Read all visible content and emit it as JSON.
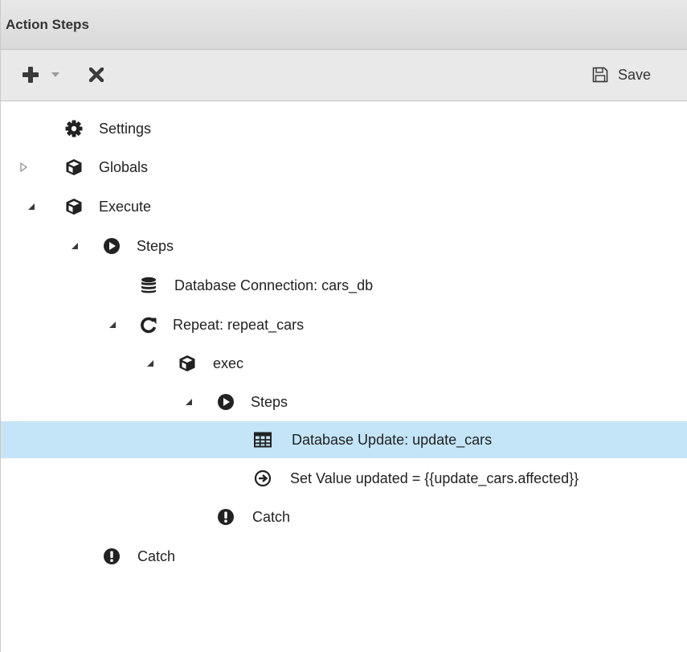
{
  "panel": {
    "title": "Action Steps"
  },
  "toolbar": {
    "add_icon": "plus-icon",
    "add_dropdown_icon": "caret-down-icon",
    "delete_icon": "close-icon",
    "save_icon": "floppy-disk-icon",
    "save_label": "Save"
  },
  "tree": {
    "nodes": [
      {
        "label": "Settings",
        "icon": "gear-icon",
        "toggle": "none",
        "depth": 0
      },
      {
        "label": "Globals",
        "icon": "cube-icon",
        "toggle": "collapsed",
        "depth": 0
      },
      {
        "label": "Execute",
        "icon": "cube-icon",
        "toggle": "expanded",
        "depth": 0
      },
      {
        "label": "Steps",
        "icon": "play-circle-icon",
        "toggle": "expanded",
        "depth": 1
      },
      {
        "label": "Database Connection: cars_db",
        "icon": "database-icon",
        "toggle": "none",
        "depth": 2
      },
      {
        "label": "Repeat: repeat_cars",
        "icon": "refresh-icon",
        "toggle": "expanded",
        "depth": 2
      },
      {
        "label": "exec",
        "icon": "cube-icon",
        "toggle": "expanded",
        "depth": 3
      },
      {
        "label": "Steps",
        "icon": "play-circle-icon",
        "toggle": "expanded",
        "depth": 4
      },
      {
        "label": "Database Update: update_cars",
        "icon": "table-icon",
        "toggle": "none",
        "depth": 5,
        "selected": true
      },
      {
        "label": "Set Value updated = {{update_cars.affected}}",
        "icon": "arrow-circle-right-icon",
        "toggle": "none",
        "depth": 5
      },
      {
        "label": "Catch",
        "icon": "exclamation-circle-icon",
        "toggle": "none",
        "depth": 4
      },
      {
        "label": "Catch",
        "icon": "exclamation-circle-icon",
        "toggle": "none",
        "depth": 1
      }
    ]
  },
  "colors": {
    "selected_row": "#c3e5f7",
    "icon": "#222222",
    "toolbar_icon": "#3a3a3a",
    "toggle": "#555555"
  }
}
